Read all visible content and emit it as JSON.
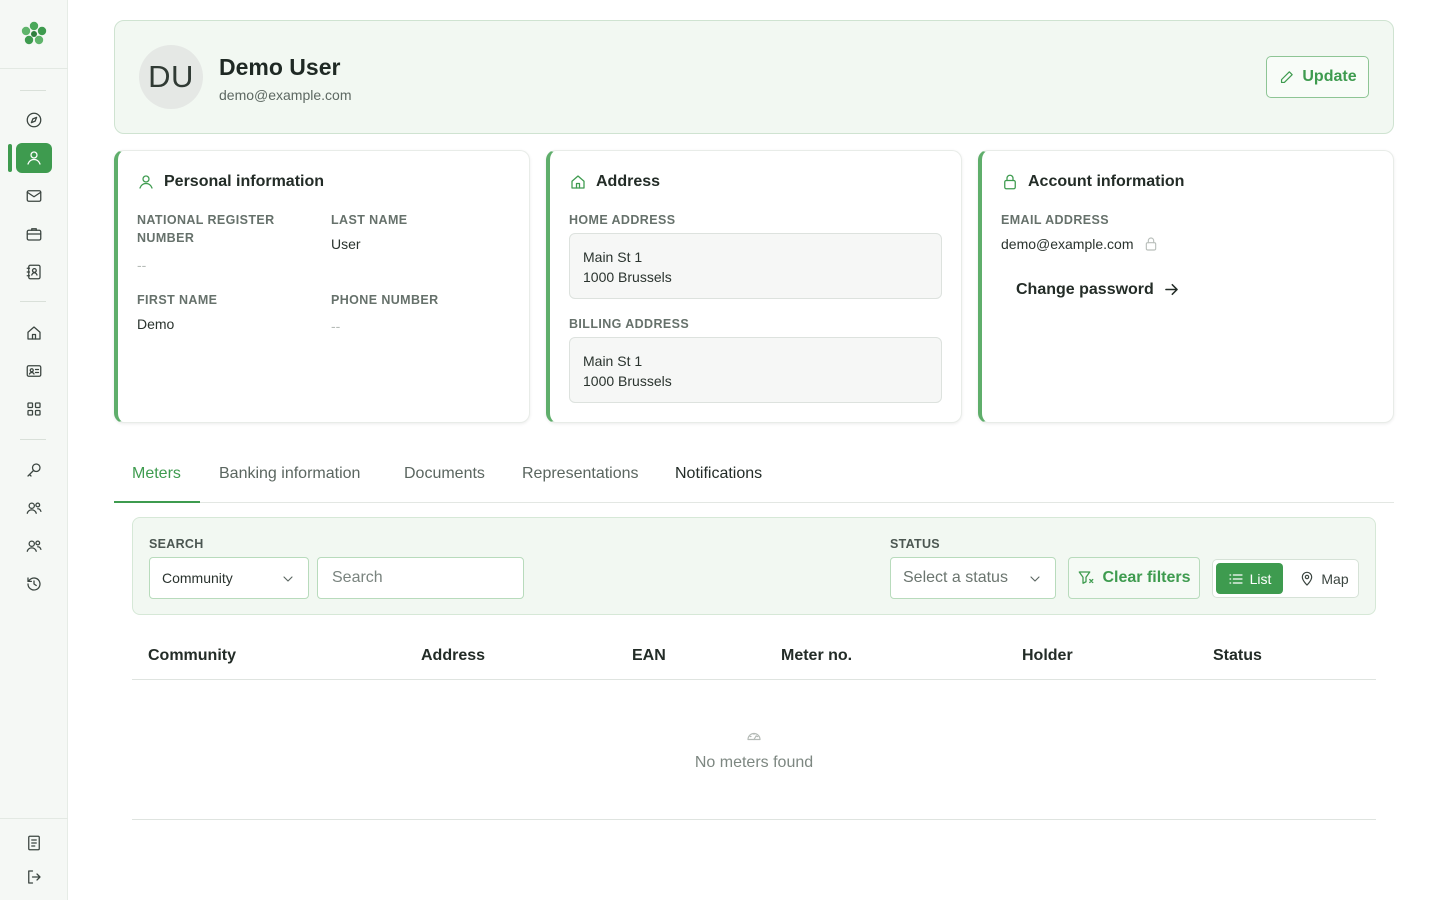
{
  "sidebar": {
    "logo_icon": "clover-logo-icon",
    "items_top": [
      "compass-icon",
      "user-icon",
      "mail-icon",
      "briefcase-icon",
      "contact-book-icon"
    ],
    "items_mid": [
      "home-icon",
      "id-card-icon",
      "grid-icon"
    ],
    "items_low": [
      "key-icon",
      "users-icon",
      "users-group-icon",
      "history-icon"
    ],
    "items_bottom": [
      "document-list-icon",
      "logout-icon"
    ],
    "active_item": "user-icon"
  },
  "profile": {
    "initials": "DU",
    "name": "Demo User",
    "email": "demo@example.com",
    "update_label": "Update"
  },
  "personal": {
    "title": "Personal information",
    "national_label": "NATIONAL REGISTER NUMBER",
    "national_value": "--",
    "last_name_label": "LAST NAME",
    "last_name_value": "User",
    "first_name_label": "FIRST NAME",
    "first_name_value": "Demo",
    "phone_label": "PHONE NUMBER",
    "phone_value": "--"
  },
  "address": {
    "title": "Address",
    "home_label": "HOME ADDRESS",
    "home_line1": "Main St 1",
    "home_line2": "1000 Brussels",
    "billing_label": "BILLING ADDRESS",
    "billing_line1": "Main St 1",
    "billing_line2": "1000 Brussels"
  },
  "account": {
    "title": "Account information",
    "email_label": "EMAIL ADDRESS",
    "email_value": "demo@example.com",
    "change_password_label": "Change password"
  },
  "tabs": {
    "meters": "Meters",
    "banking": "Banking information",
    "documents": "Documents",
    "representations": "Representations",
    "notifications": "Notifications",
    "active": "Meters"
  },
  "filters": {
    "search_label": "SEARCH",
    "search_field_select": "Community",
    "search_placeholder": "Search",
    "status_label": "STATUS",
    "status_placeholder": "Select a status",
    "clear_label": "Clear filters",
    "view_list_label": "List",
    "view_map_label": "Map",
    "active_view": "List"
  },
  "table": {
    "columns": [
      "Community",
      "Address",
      "EAN",
      "Meter no.",
      "Holder",
      "Status"
    ],
    "empty_text": "No meters found"
  },
  "colors": {
    "accent": "#3e9b4f",
    "card_bg": "#f2f8f2"
  }
}
